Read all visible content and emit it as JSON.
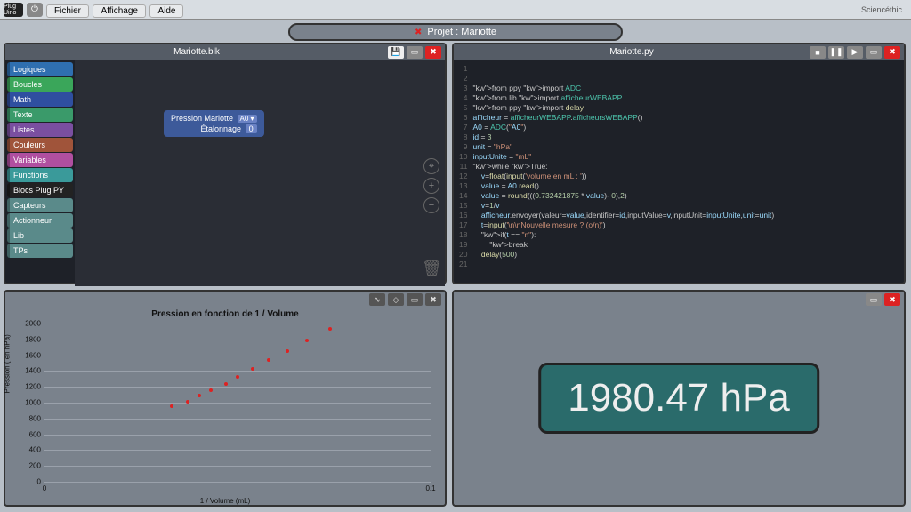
{
  "topbar": {
    "logo": "Plug Uino",
    "menus": [
      "Fichier",
      "Affichage",
      "Aide"
    ],
    "brand": "Sciencéthic"
  },
  "project": {
    "label": "Projet : Mariotte"
  },
  "panel1": {
    "title": "Mariotte.blk",
    "categories": [
      {
        "label": "Logiques",
        "color": "#2f6fb0"
      },
      {
        "label": "Boucles",
        "color": "#3aa65a"
      },
      {
        "label": "Math",
        "color": "#2f4fa0"
      },
      {
        "label": "Texte",
        "color": "#3a9a6a"
      },
      {
        "label": "Listes",
        "color": "#7a4fa0"
      },
      {
        "label": "Couleurs",
        "color": "#a0543a"
      },
      {
        "label": "Variables",
        "color": "#b04fa0"
      },
      {
        "label": "Functions",
        "color": "#3a9a9a"
      },
      {
        "label": "Blocs Plug PY",
        "color": "#222"
      },
      {
        "label": "Capteurs",
        "color": "#5a8a8a"
      },
      {
        "label": "Actionneur",
        "color": "#5a8a8a"
      },
      {
        "label": "Lib",
        "color": "#5a8a8a"
      },
      {
        "label": "TPs",
        "color": "#5a8a8a"
      }
    ],
    "block": {
      "line1": "Pression Mariotte",
      "tag": "A0 ▾",
      "line2": "Étalonnage",
      "val": "0"
    }
  },
  "panel2": {
    "title": "Mariotte.py",
    "lines": [
      "",
      "",
      "from ppy import ADC",
      "from lib import afficheurWEBAPP",
      "from ppy import delay",
      "afficheur = afficheurWEBAPP.afficheursWEBAPP()",
      "A0 = ADC(\"A0\")",
      "id = 3",
      "unit = \"hPa\"",
      "inputUnite = \"mL\"",
      "while True:",
      "    v=float(input('volume en mL : '))",
      "    value = A0.read()",
      "    value = round(((0.732421875 * value)- 0),2)",
      "    v=1/v",
      "    afficheur.envoyer(valeur=value,identifier=id,inputValue=v,inputUnit=inputUnite,unit=unit)",
      "    t=input('\\n\\nNouvelle mesure ? (o/n)')",
      "    if(t == \"n\"):",
      "        break",
      "    delay(500)",
      ""
    ]
  },
  "chart_data": {
    "type": "scatter",
    "title": "Pression en fonction de 1 / Volume",
    "xlabel": "1 / Volume (mL)",
    "ylabel": "Pression ( en hPa)",
    "xlim": [
      0,
      0.1
    ],
    "ylim": [
      0,
      2000
    ],
    "yticks": [
      0,
      200,
      400,
      600,
      800,
      1000,
      1200,
      1400,
      1600,
      1800,
      2000
    ],
    "xticks": [
      0,
      0.1
    ],
    "x": [
      0.033,
      0.037,
      0.04,
      0.043,
      0.047,
      0.05,
      0.054,
      0.058,
      0.063,
      0.068,
      0.074
    ],
    "y": [
      1000,
      1060,
      1130,
      1200,
      1280,
      1370,
      1470,
      1580,
      1700,
      1830,
      1980
    ]
  },
  "readout": {
    "value": "1980.47 hPa"
  }
}
